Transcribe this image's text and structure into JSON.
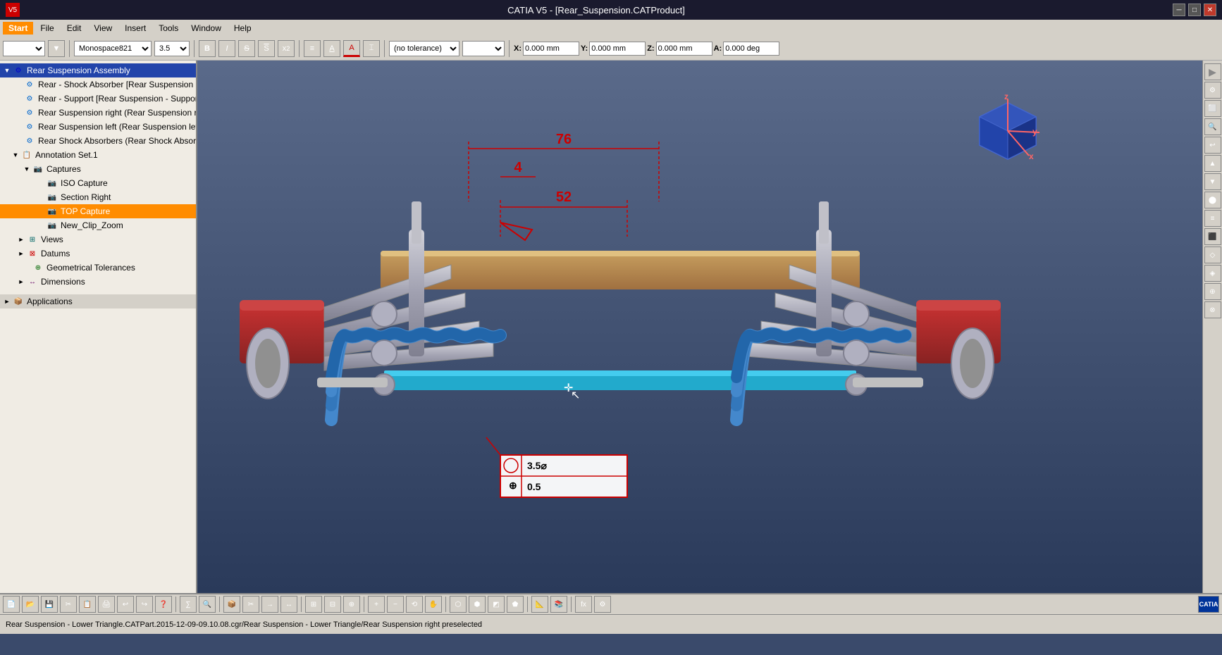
{
  "titlebar": {
    "title": "CATIA V5 - [Rear_Suspension.CATProduct]",
    "win_min": "─",
    "win_max": "□",
    "win_close": "✕"
  },
  "menubar": {
    "items": [
      "Start",
      "File",
      "Edit",
      "View",
      "Insert",
      "Tools",
      "Window",
      "Help"
    ]
  },
  "toolbar1": {
    "font": "Monospace821",
    "size": "3.5",
    "bold": "B",
    "italic": "I",
    "strike": "S",
    "overline": "S̄",
    "sup": "x²",
    "align_left": "≡",
    "underline_a": "A",
    "color_a": "A",
    "tolerance_label": "(no tolerance)",
    "x_label": "X:",
    "x_val": "0.000 mm",
    "y_label": "Y:",
    "y_val": "0.000 mm",
    "z_label": "Z:",
    "z_val": "0.000 mm",
    "a_label": "A:",
    "a_val": "0.000 deg"
  },
  "tree": {
    "items": [
      {
        "id": "rear-suspension-assembly",
        "label": "Rear Suspension Assembly",
        "level": 0,
        "selected": true,
        "icon": "assy",
        "expand": "▼"
      },
      {
        "id": "shock-absorber",
        "label": "Rear - Shock Absorber [Rear Suspension - Damper Support.CATPart]",
        "level": 1,
        "icon": "part",
        "expand": ""
      },
      {
        "id": "support",
        "label": "Rear - Support [Rear Suspension - Support.CATPart]",
        "level": 1,
        "icon": "part",
        "expand": ""
      },
      {
        "id": "susp-right",
        "label": "Rear Suspension right (Rear Suspension right)",
        "level": 1,
        "icon": "part",
        "expand": ""
      },
      {
        "id": "susp-left",
        "label": "Rear Suspension left (Rear Suspension left)",
        "level": 1,
        "icon": "part",
        "expand": ""
      },
      {
        "id": "shock-absorbers",
        "label": "Rear Shock Absorbers (Rear Shock Absorbers)",
        "level": 1,
        "icon": "part",
        "expand": ""
      },
      {
        "id": "annotation-set",
        "label": "Annotation Set.1",
        "level": 1,
        "icon": "annot",
        "expand": "▼"
      },
      {
        "id": "captures",
        "label": "Captures",
        "level": 2,
        "icon": "capture",
        "expand": "▼"
      },
      {
        "id": "iso-capture",
        "label": "ISO Capture",
        "level": 3,
        "icon": "capture-item",
        "expand": ""
      },
      {
        "id": "section-right",
        "label": "Section Right",
        "level": 3,
        "icon": "capture-item",
        "expand": ""
      },
      {
        "id": "top-capture",
        "label": "TOP Capture",
        "level": 3,
        "icon": "capture-item",
        "expand": "",
        "highlighted": true
      },
      {
        "id": "new-clip-zoom",
        "label": "New_Clip_Zoom",
        "level": 3,
        "icon": "capture-item",
        "expand": ""
      },
      {
        "id": "views",
        "label": "Views",
        "level": 2,
        "icon": "view",
        "expand": "►"
      },
      {
        "id": "datums",
        "label": "Datums",
        "level": 2,
        "icon": "datum",
        "expand": "►"
      },
      {
        "id": "geo-tolerances",
        "label": "Geometrical Tolerances",
        "level": 2,
        "icon": "tol",
        "expand": ""
      },
      {
        "id": "dimensions",
        "label": "Dimensions",
        "level": 2,
        "icon": "dim",
        "expand": "►"
      },
      {
        "id": "applications",
        "label": "Applications",
        "level": 0,
        "icon": "app",
        "expand": "►"
      }
    ]
  },
  "dimensions": {
    "dim76": "76",
    "dim4": "4",
    "dim52": "52"
  },
  "gdt": {
    "row1_sym": "○",
    "row1_val": "3.5⌀",
    "row2_sym": "⊕",
    "row2_val": "0.5"
  },
  "statusbar": {
    "text": "Rear Suspension - Lower Triangle.CATPart.2015-12-09-09.10.08.cgr/Rear Suspension - Lower Triangle/Rear Suspension right preselected"
  },
  "right_toolbar": {
    "buttons": [
      "▶",
      "⚙",
      "⬜",
      "🔍",
      "◀",
      "▲",
      "▼",
      "⬤",
      "≡",
      "⬛",
      "◇",
      "◈"
    ]
  },
  "bottom_toolbar": {
    "buttons": [
      "📄",
      "📂",
      "💾",
      "✂",
      "📋",
      "🔄",
      "↩",
      "↪",
      "❓",
      "∑",
      "🔍",
      "⚙",
      "📦",
      "✂",
      "→",
      "↔",
      "⊞",
      "🔄",
      "🔍",
      "+",
      "−",
      "⟲",
      "⬜",
      "⬛",
      "◩",
      "⬡",
      "⬢",
      "⊕",
      "⊗",
      "⬟",
      "⬠"
    ]
  },
  "colors": {
    "accent_blue": "#2244aa",
    "highlight_orange": "#ff8c00",
    "bg_tree": "#f0ece4",
    "bg_toolbar": "#d4d0c8",
    "bg_viewport": "#3a4a6b",
    "text_dark": "#000000",
    "dim_red": "#cc0000",
    "spring_blue": "#4488cc"
  }
}
